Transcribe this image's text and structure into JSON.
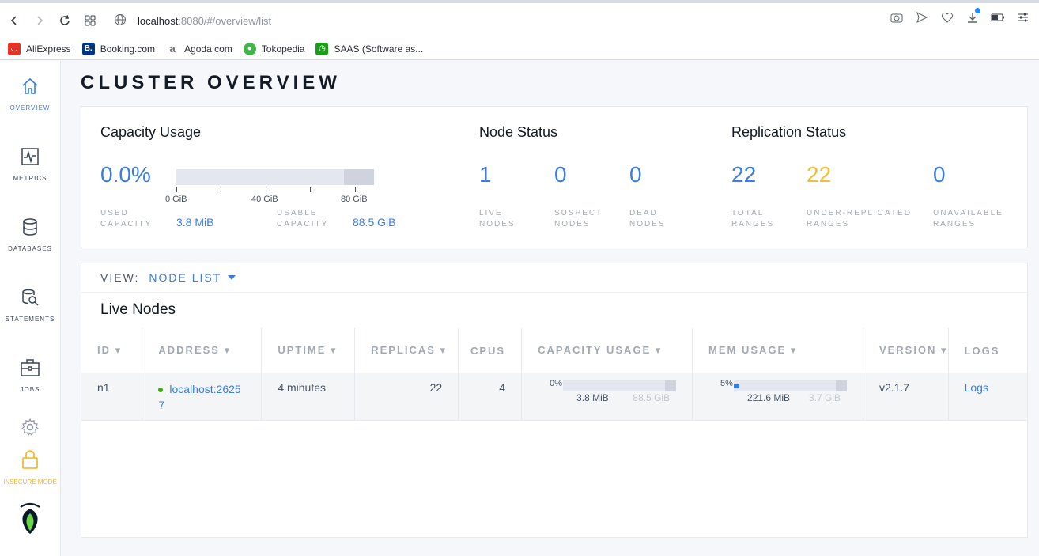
{
  "browser": {
    "url_host": "localhost",
    "url_rest": ":8080/#/overview/list",
    "bookmarks": [
      {
        "label": "AliExpress",
        "icon": "aliexpress-icon",
        "color": "#e43226"
      },
      {
        "label": "Booking.com",
        "icon": "booking-icon",
        "color": "#003580"
      },
      {
        "label": "Agoda.com",
        "icon": "agoda-icon",
        "color": "#6b6b6b"
      },
      {
        "label": "Tokopedia",
        "icon": "tokopedia-icon",
        "color": "#42b549"
      },
      {
        "label": "SAAS (Software as...",
        "icon": "saas-icon",
        "color": "#1a9e1a"
      }
    ]
  },
  "sidebar": {
    "items": [
      {
        "label": "OVERVIEW",
        "icon": "home-icon",
        "active": true
      },
      {
        "label": "METRICS",
        "icon": "metrics-icon",
        "active": false
      },
      {
        "label": "DATABASES",
        "icon": "database-icon",
        "active": false
      },
      {
        "label": "STATEMENTS",
        "icon": "statements-icon",
        "active": false
      },
      {
        "label": "JOBS",
        "icon": "jobs-icon",
        "active": false
      }
    ],
    "insecure_label": "INSECURE MODE",
    "insecure_color": "#f2b61d"
  },
  "page": {
    "title": "CLUSTER OVERVIEW"
  },
  "capacity": {
    "title": "Capacity Usage",
    "percent": "0.0%",
    "used_label": "USED CAPACITY",
    "used_value": "3.8 MiB",
    "usable_label": "USABLE CAPACITY",
    "usable_value": "88.5 GiB",
    "ticks": [
      "0 GiB",
      "40 GiB",
      "80 GiB"
    ]
  },
  "node_status": {
    "title": "Node Status",
    "live": "1",
    "live_label": "LIVE NODES",
    "suspect": "0",
    "suspect_label": "SUSPECT NODES",
    "dead": "0",
    "dead_label": "DEAD NODES"
  },
  "replication": {
    "title": "Replication Status",
    "total": "22",
    "total_label": "TOTAL RANGES",
    "under": "22",
    "under_label": "UNDER-REPLICATED RANGES",
    "unavailable": "0",
    "unavailable_label": "UNAVAILABLE RANGES",
    "warn_color": "#f2c037"
  },
  "view": {
    "label": "VIEW:",
    "value": "NODE LIST"
  },
  "live_nodes": {
    "title": "Live Nodes",
    "columns": [
      "ID ▾",
      "ADDRESS ▾",
      "UPTIME ▾",
      "REPLICAS ▾",
      "CPUS",
      "CAPACITY USAGE ▾",
      "MEM USAGE ▾",
      "VERSION ▾",
      "LOGS"
    ],
    "rows": [
      {
        "id": "n1",
        "address": "localhost:26257",
        "uptime": "4 minutes",
        "replicas": "22",
        "cpus": "4",
        "capacity_pct": "0%",
        "capacity_used": "3.8 MiB",
        "capacity_total": "88.5 GiB",
        "capacity_fraction": 0.0,
        "mem_pct": "5%",
        "mem_used": "221.6 MiB",
        "mem_total": "3.7 GiB",
        "mem_fraction": 0.05,
        "version": "v2.1.7",
        "logs": "Logs"
      }
    ]
  }
}
